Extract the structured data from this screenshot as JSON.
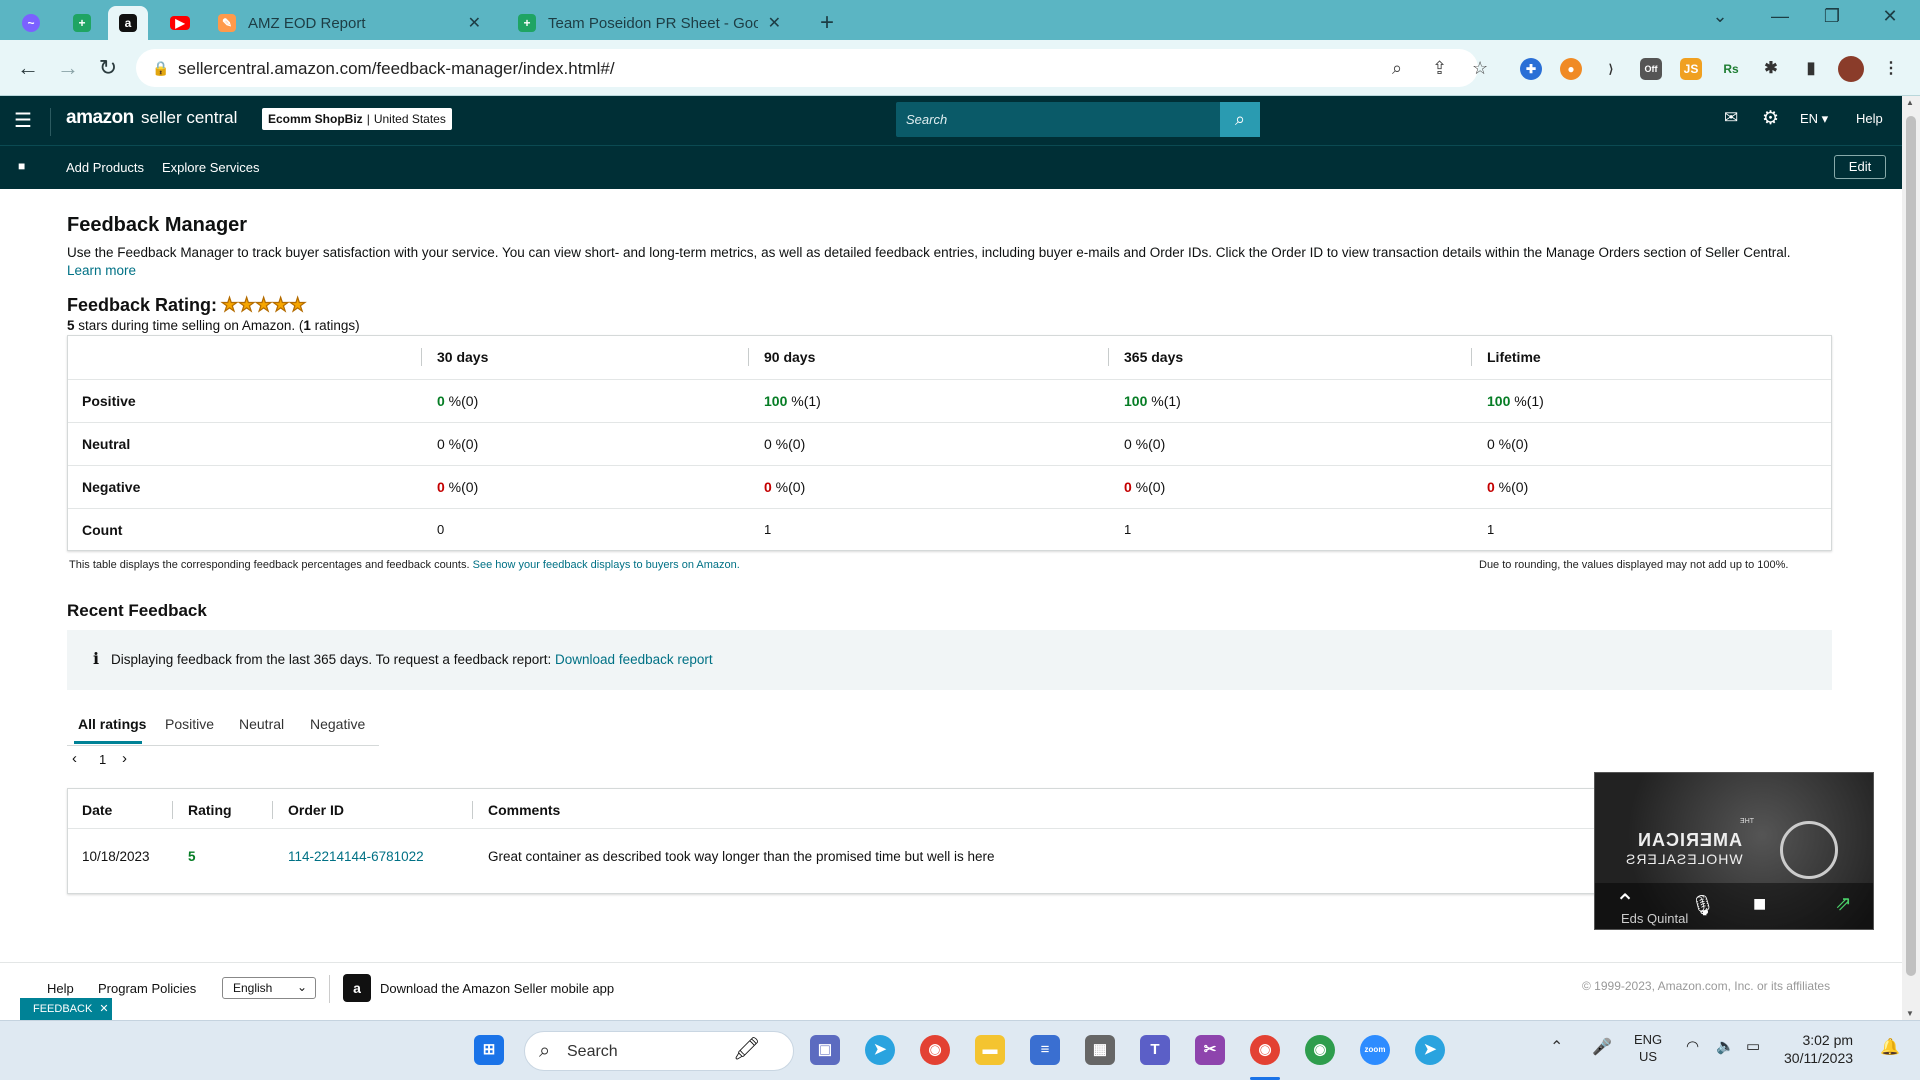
{
  "browser": {
    "tabs": [
      {
        "icon": "messenger-icon",
        "color": "#7b61ff"
      },
      {
        "icon": "sheets-icon",
        "color": "#1fa463"
      },
      {
        "icon": "amazon-icon",
        "color": "#111111"
      },
      {
        "icon": "youtube-icon",
        "color": "#ff0000"
      },
      {
        "title": "AMZ EOD Report",
        "icon": "zapier-icon"
      },
      {
        "title": "Team Poseidon PR Sheet - Goog",
        "icon": "sheets-icon"
      }
    ],
    "new_tab": "+",
    "url": "sellercentral.amazon.com/feedback-manager/index.html#/",
    "ext_off_badge": "Off",
    "ext_js_badge": "JS",
    "ext_rs_badge": "Rs"
  },
  "sc_header": {
    "logo_text": "amazon",
    "logo_suffix": "seller central",
    "store_name": "Ecomm ShopBiz",
    "store_region": "United States",
    "search_placeholder": "Search",
    "language": "EN",
    "help": "Help"
  },
  "subnav": {
    "items": [
      "Add Products",
      "Explore Services"
    ],
    "edit_label": "Edit"
  },
  "page": {
    "title": "Feedback Manager",
    "description": "Use the Feedback Manager to track buyer satisfaction with your service. You can view short- and long-term metrics, as well as detailed feedback entries, including buyer e-mails and Order IDs. Click the Order ID to view transaction details within the Manage Orders section of Seller Central.",
    "learn_more": "Learn more",
    "rating_label": "Feedback Rating:",
    "stars": 5,
    "rating_summary_stars": "5",
    "rating_summary_text1": " stars during time selling on Amazon. (",
    "rating_summary_count": "1",
    "rating_summary_text2": " ratings)"
  },
  "rating_table": {
    "columns": [
      "30 days",
      "90 days",
      "365 days",
      "Lifetime"
    ],
    "rows": [
      {
        "label": "Positive",
        "cells": [
          {
            "v": "0",
            "s": " %(0)"
          },
          {
            "v": "100",
            "s": " %(1)"
          },
          {
            "v": "100",
            "s": " %(1)"
          },
          {
            "v": "100",
            "s": " %(1)"
          }
        ]
      },
      {
        "label": "Neutral",
        "cells": [
          {
            "v": "0",
            "s": " %(0)"
          },
          {
            "v": "0",
            "s": " %(0)"
          },
          {
            "v": "0",
            "s": " %(0)"
          },
          {
            "v": "0",
            "s": " %(0)"
          }
        ]
      },
      {
        "label": "Negative",
        "cells": [
          {
            "v": "0",
            "s": " %(0)"
          },
          {
            "v": "0",
            "s": " %(0)"
          },
          {
            "v": "0",
            "s": " %(0)"
          },
          {
            "v": "0",
            "s": " %(0)"
          }
        ]
      },
      {
        "label": "Count",
        "cells": [
          {
            "v": "0",
            "s": ""
          },
          {
            "v": "1",
            "s": ""
          },
          {
            "v": "1",
            "s": ""
          },
          {
            "v": "1",
            "s": ""
          }
        ]
      }
    ],
    "note": "This table displays the corresponding feedback percentages and feedback counts.",
    "note_link": "See how your feedback displays to buyers on Amazon.",
    "rounding_note": "Due to rounding, the values displayed may not add up to 100%."
  },
  "recent": {
    "title": "Recent Feedback",
    "info_text": "Displaying feedback from the last 365 days. To request a feedback report:",
    "info_link": "Download feedback report",
    "tabs": [
      "All ratings",
      "Positive",
      "Neutral",
      "Negative"
    ],
    "page": "1",
    "headers": [
      "Date",
      "Rating",
      "Order ID",
      "Comments"
    ],
    "rows": [
      {
        "date": "10/18/2023",
        "rating": "5",
        "order_id": "114-2214144-6781022",
        "comment": "Great container as described took way longer than the promised time but well is here"
      }
    ]
  },
  "footer": {
    "help": "Help",
    "program_policies": "Program Policies",
    "language": "English",
    "app_text": "Download the Amazon Seller mobile app",
    "copyright": "© 1999-2023, Amazon.com, Inc. or its affiliates",
    "feedback_tab": "FEEDBACK"
  },
  "zoom_overlay": {
    "name": "Eds Quintal",
    "logo_text": "AMERICAN",
    "logo_text2": "WHOLESALERS",
    "logo_small": "THE"
  },
  "taskbar": {
    "search_placeholder": "Search",
    "lang": "ENG",
    "region": "US",
    "time": "3:02 pm",
    "date": "30/11/2023",
    "zoom_label": "zoom"
  }
}
